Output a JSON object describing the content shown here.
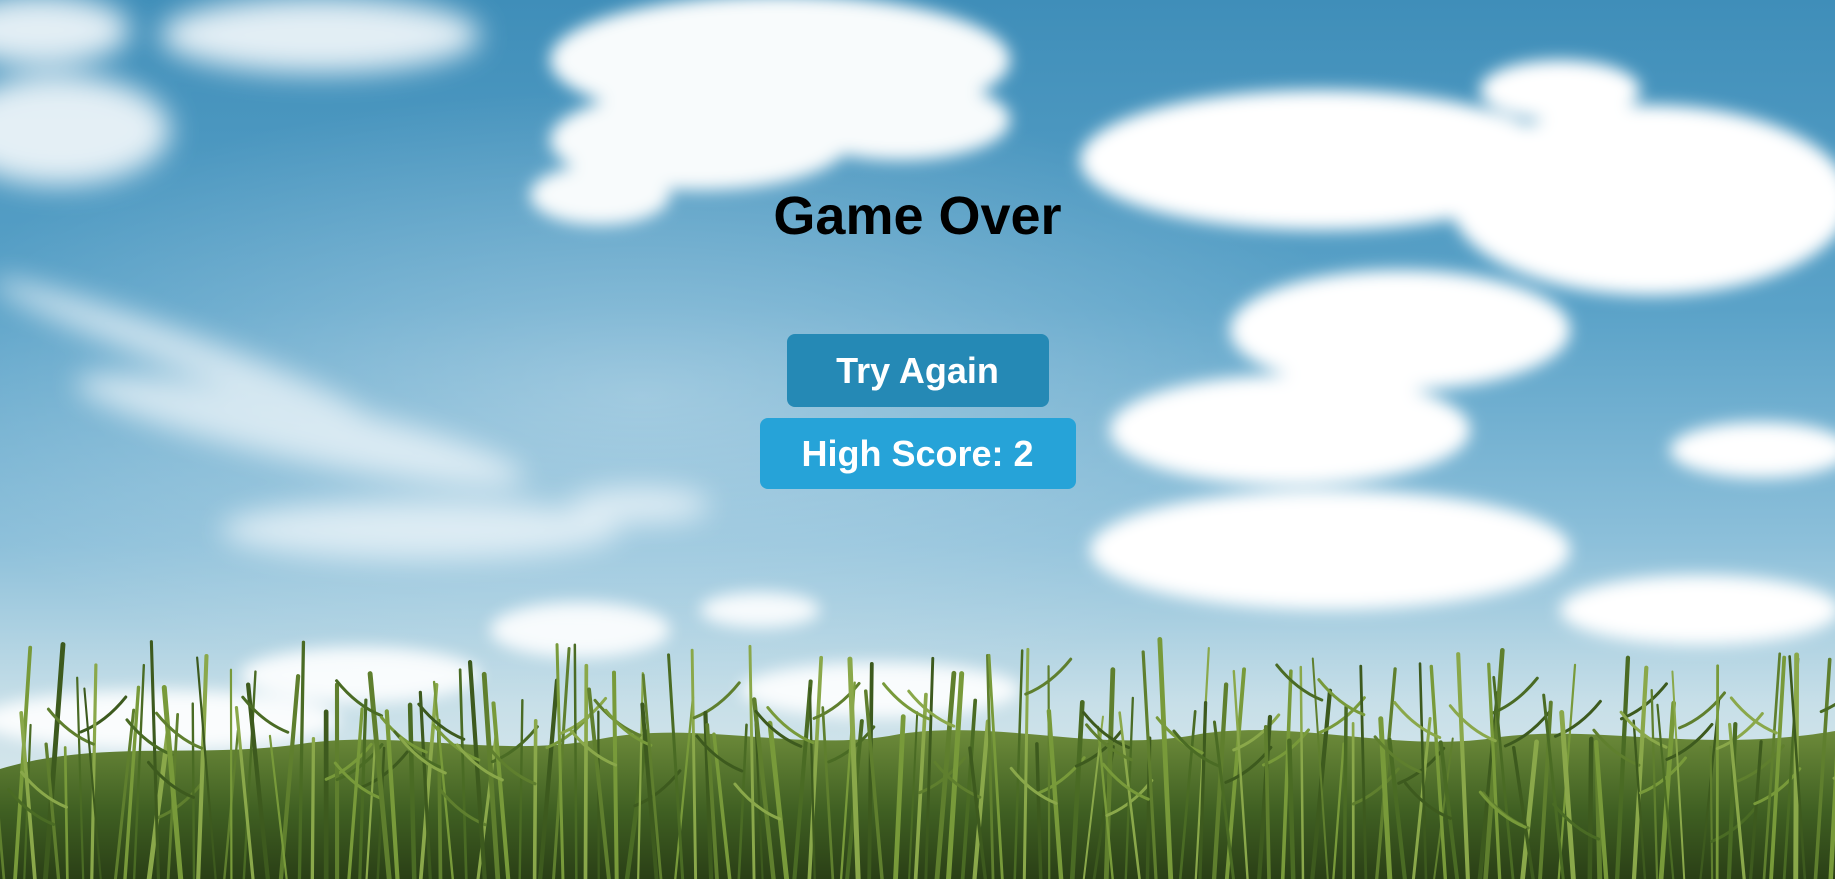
{
  "screen": {
    "title": "Game Over"
  },
  "actions": {
    "try_again_label": "Try Again",
    "high_score_label": "High Score: 2"
  },
  "background": {
    "sky_icon": "sky-with-clouds",
    "ground_icon": "cornfield"
  },
  "colors": {
    "try_again_button": "#2589b5",
    "high_score_button": "#26a3d8",
    "title_text": "#000000",
    "button_text": "#ffffff"
  }
}
